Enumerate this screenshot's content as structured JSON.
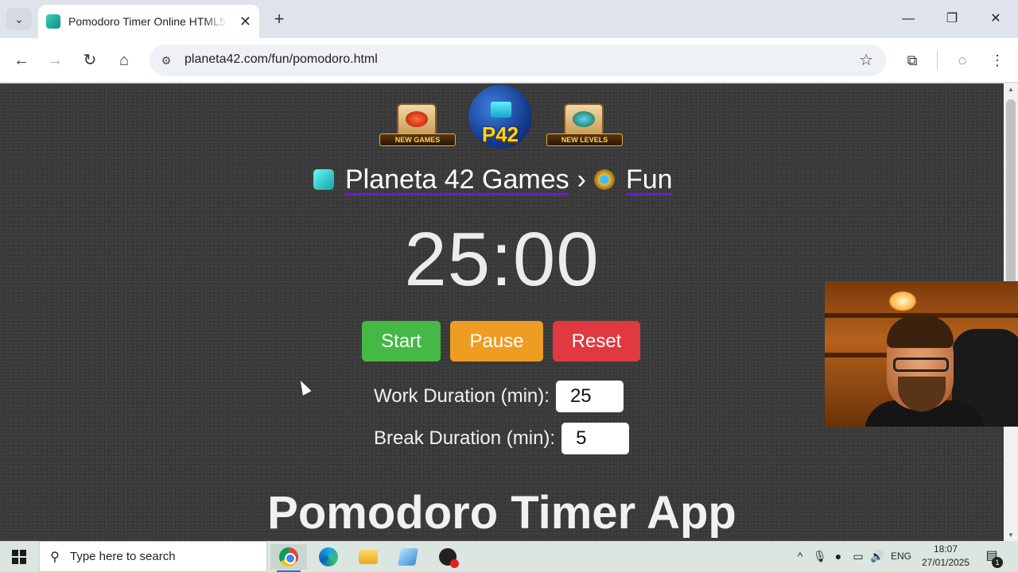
{
  "browser": {
    "tab_title": "Pomodoro Timer Online HTML5",
    "url": "planeta42.com/fun/pomodoro.html"
  },
  "header": {
    "new_games_label": "NEW GAMES",
    "new_levels_label": "NEW LEVELS",
    "logo_text": "P42"
  },
  "breadcrumb": {
    "home": "Planeta 42 Games",
    "separator": "›",
    "section": "Fun"
  },
  "timer": {
    "display": "25:00"
  },
  "controls": {
    "start": "Start",
    "pause": "Pause",
    "reset": "Reset"
  },
  "settings": {
    "work_label": "Work Duration (min):",
    "work_value": "25",
    "break_label": "Break Duration (min):",
    "break_value": "5"
  },
  "page_heading": "Pomodoro Timer App",
  "taskbar": {
    "search_placeholder": "Type here to search",
    "language": "ENG",
    "time": "18:07",
    "date": "27/01/2025",
    "notification_count": "1"
  },
  "colors": {
    "start": "#45b845",
    "pause": "#ef9c22",
    "reset": "#e0393f",
    "background": "#3a3a3a"
  },
  "icons": [
    "tab-search-icon",
    "close-icon",
    "plus-icon",
    "minimize-icon",
    "restore-icon",
    "back-icon",
    "forward-icon",
    "reload-icon",
    "home-icon",
    "site-info-icon",
    "star-icon",
    "extensions-icon",
    "profile-icon",
    "menu-icon",
    "windows-icon",
    "search-icon",
    "chrome-icon",
    "edge-icon",
    "folder-icon",
    "notes-icon",
    "recorder-icon"
  ]
}
